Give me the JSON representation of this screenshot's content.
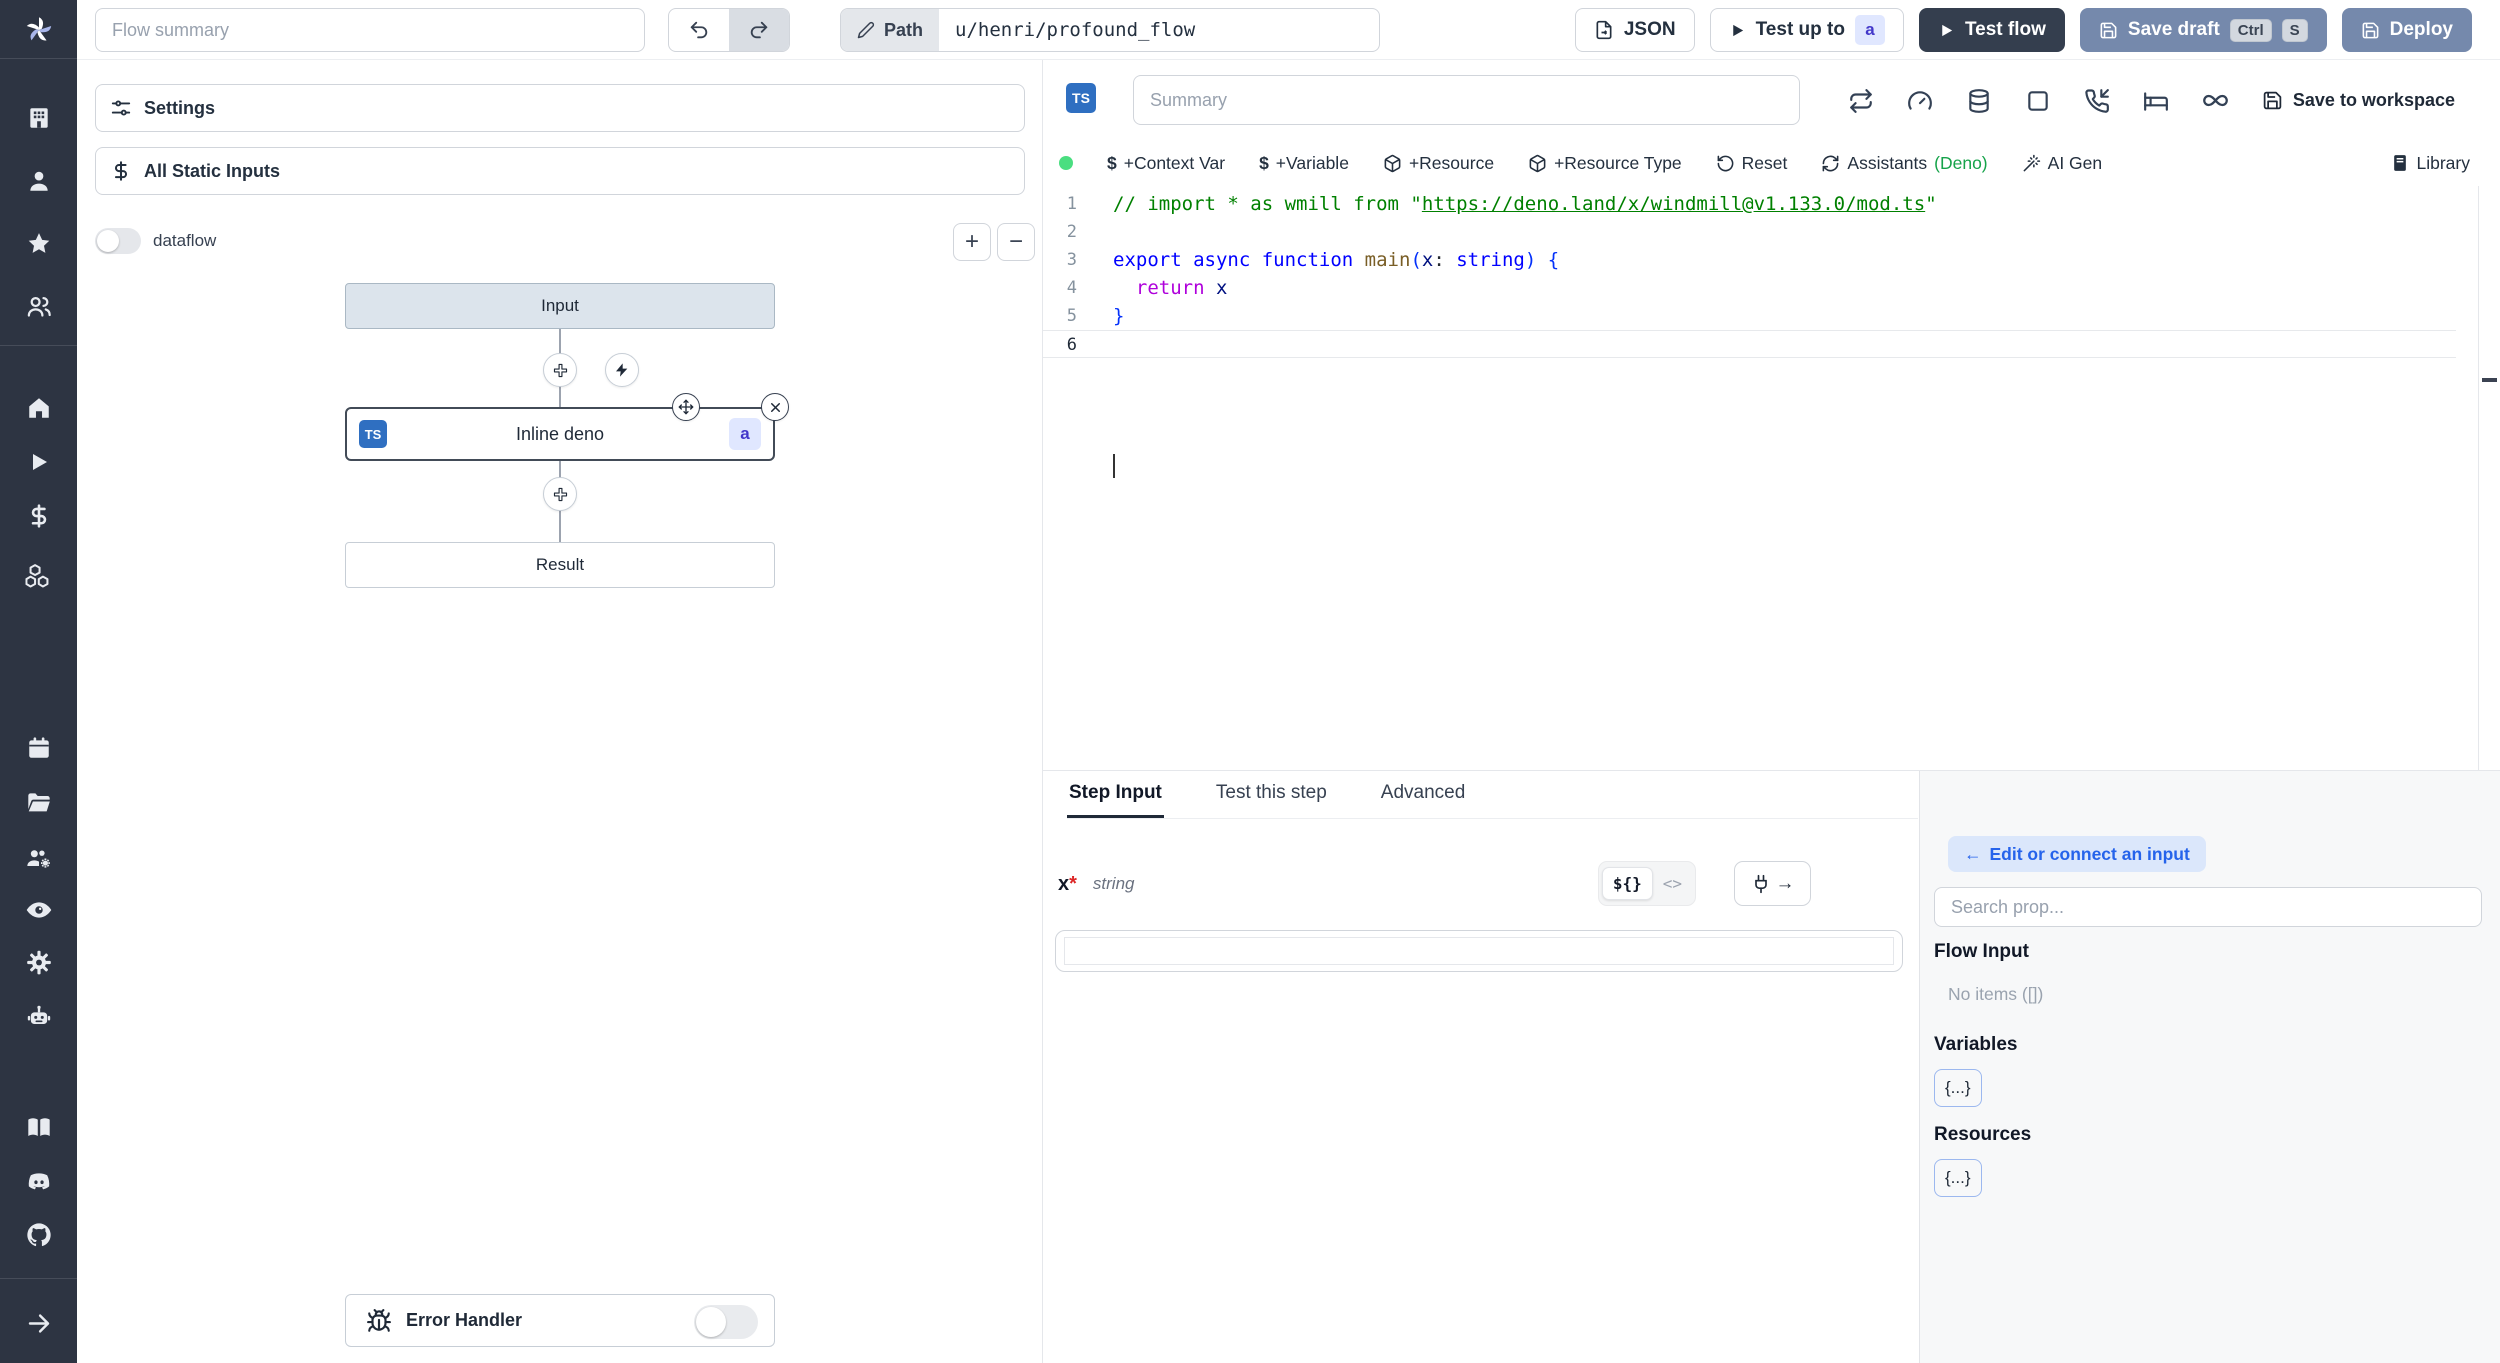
{
  "colors": {
    "sidebar_bg": "#2d3442",
    "steel_button": "#7589ac",
    "dark_button": "#343e4e",
    "ts_badge": "#2f6fc1",
    "badge_a_bg": "#e0e7ff",
    "badge_a_text": "#4338ca",
    "green_dot": "#4ade80",
    "deno_green": "#16a34a",
    "connect_btn_bg": "#dbe7fb",
    "connect_btn_text": "#2563eb",
    "input_node_bg": "#dce4ec"
  },
  "sidebar": {
    "icons": [
      "windmill-logo",
      "building",
      "user",
      "star",
      "users",
      "home",
      "play",
      "dollar",
      "cubes",
      "calendar",
      "folder-open",
      "users-gear",
      "eye",
      "gear",
      "bot",
      "book",
      "discord",
      "github",
      "arrow-right"
    ]
  },
  "topbar": {
    "flow_summary_placeholder": "Flow summary",
    "path_label": "Path",
    "path_value": "u/henri/profound_flow",
    "json_button": "JSON",
    "test_up_to_label": "Test up to",
    "test_up_to_badge": "a",
    "test_flow_label": "Test flow",
    "save_draft_label": "Save draft",
    "kbd_ctrl": "Ctrl",
    "kbd_s": "S",
    "deploy_label": "Deploy"
  },
  "flow_panel": {
    "settings_label": "Settings",
    "all_static_inputs_label": "All Static Inputs",
    "dataflow_label": "dataflow",
    "zoom_in_label": "+",
    "zoom_out_label": "−",
    "input_node_label": "Input",
    "step_node_label": "Inline deno",
    "step_node_lang": "TS",
    "step_node_badge": "a",
    "result_node_label": "Result",
    "error_handler_label": "Error Handler"
  },
  "editor": {
    "lang_badge": "TS",
    "summary_placeholder": "Summary",
    "save_to_workspace_label": "Save to workspace",
    "toolbar": {
      "context_var": "+Context Var",
      "variable": "+Variable",
      "resource": "+Resource",
      "resource_type": "+Resource Type",
      "reset": "Reset",
      "assistants": "Assistants",
      "assistants_lang": "(Deno)",
      "ai_gen": "AI Gen",
      "library": "Library"
    },
    "code_lines": [
      {
        "n": "1",
        "segs": [
          {
            "t": "// import * as wmill from \"",
            "c": "cmt"
          },
          {
            "t": "https://deno.land/x/windmill@v1.133.0/mod.ts",
            "c": "cmt lnk"
          },
          {
            "t": "\"",
            "c": "cmt"
          }
        ]
      },
      {
        "n": "2",
        "segs": []
      },
      {
        "n": "3",
        "segs": [
          {
            "t": "export async function ",
            "c": "kw"
          },
          {
            "t": "main",
            "c": "fn"
          },
          {
            "t": "(",
            "c": "br"
          },
          {
            "t": "x",
            "c": "vr"
          },
          {
            "t": ": ",
            "c": "pl"
          },
          {
            "t": "string",
            "c": "kw"
          },
          {
            "t": ") {",
            "c": "br"
          }
        ]
      },
      {
        "n": "4",
        "segs": [
          {
            "t": "  return",
            "c": "ctl"
          },
          {
            "t": " x",
            "c": "vr"
          }
        ]
      },
      {
        "n": "5",
        "segs": [
          {
            "t": "}",
            "c": "br"
          }
        ]
      },
      {
        "n": "6",
        "segs": [],
        "active": true
      }
    ]
  },
  "step_panel": {
    "tabs": [
      "Step Input",
      "Test this step",
      "Advanced"
    ],
    "active_tab": "Step Input",
    "arg_name": "x",
    "arg_required_mark": "*",
    "arg_type": "string",
    "toggle_expr": "${}",
    "toggle_raw": "<>",
    "plug_arrow": "→"
  },
  "connect_panel": {
    "edit_connect_arrow": "←",
    "edit_connect_label": "Edit or connect an input",
    "search_placeholder": "Search prop...",
    "flow_input_heading": "Flow Input",
    "flow_input_empty": "No items ([])",
    "variables_heading": "Variables",
    "variables_chip": "{...}",
    "resources_heading": "Resources",
    "resources_chip": "{...}"
  }
}
